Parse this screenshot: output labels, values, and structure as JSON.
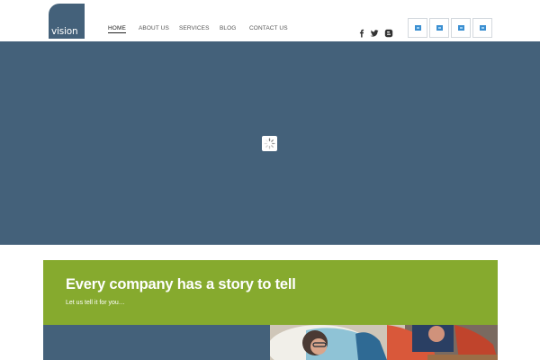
{
  "header": {
    "logo_text": "vision",
    "brand_color": "#44617a",
    "nav": [
      {
        "label": "HOME",
        "active": true
      },
      {
        "label": "ABOUT US",
        "active": false
      },
      {
        "label": "SERVICES",
        "active": false
      },
      {
        "label": "BLOG",
        "active": false
      },
      {
        "label": "CONTACT US",
        "active": false
      }
    ],
    "social_icons": [
      "facebook-icon",
      "twitter-icon",
      "blogger-icon"
    ],
    "badge_icons": [
      "broken-image-icon",
      "broken-image-icon",
      "broken-image-icon",
      "broken-image-icon"
    ]
  },
  "hero": {
    "background_color": "#44617a",
    "loader_icon": "spinner-icon"
  },
  "story": {
    "title": "Every company has a story to tell",
    "subtitle": "Let us tell it for you…",
    "background_color": "#86aa2e"
  }
}
